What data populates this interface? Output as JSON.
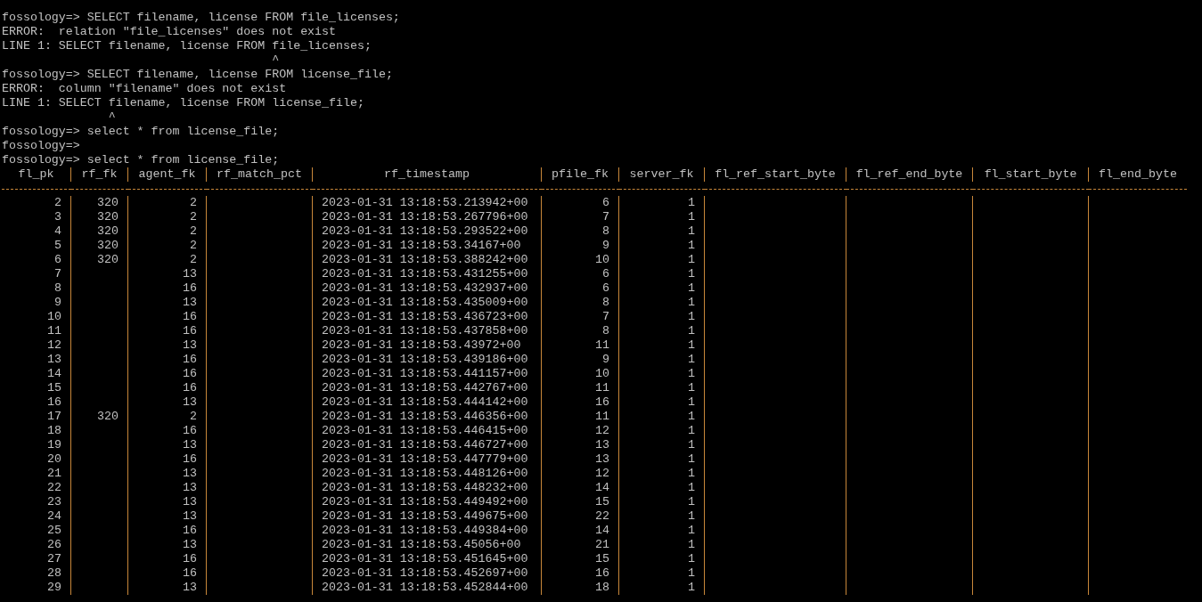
{
  "terminal": {
    "lines": [
      "fossology=> SELECT filename, license FROM file_licenses;",
      "ERROR:  relation \"file_licenses\" does not exist",
      "LINE 1: SELECT filename, license FROM file_licenses;",
      "                                      ^",
      "fossology=> SELECT filename, license FROM license_file;",
      "ERROR:  column \"filename\" does not exist",
      "LINE 1: SELECT filename, license FROM license_file;",
      "               ^",
      "fossology=> select * from license_file;",
      "fossology=>",
      "fossology=> select * from license_file;"
    ],
    "table": {
      "columns": [
        "fl_pk",
        "rf_fk",
        "agent_fk",
        "rf_match_pct",
        "rf_timestamp",
        "pfile_fk",
        "server_fk",
        "fl_ref_start_byte",
        "fl_ref_end_byte",
        "fl_start_byte",
        "fl_end_byte"
      ],
      "rows": [
        [
          "2",
          "320",
          "2",
          null,
          "2023-01-31 13:18:53.213942+00",
          "6",
          "1",
          null,
          null,
          null,
          null
        ],
        [
          "3",
          "320",
          "2",
          null,
          "2023-01-31 13:18:53.267796+00",
          "7",
          "1",
          null,
          null,
          null,
          null
        ],
        [
          "4",
          "320",
          "2",
          null,
          "2023-01-31 13:18:53.293522+00",
          "8",
          "1",
          null,
          null,
          null,
          null
        ],
        [
          "5",
          "320",
          "2",
          null,
          "2023-01-31 13:18:53.34167+00",
          "9",
          "1",
          null,
          null,
          null,
          null
        ],
        [
          "6",
          "320",
          "2",
          null,
          "2023-01-31 13:18:53.388242+00",
          "10",
          "1",
          null,
          null,
          null,
          null
        ],
        [
          "7",
          null,
          "13",
          null,
          "2023-01-31 13:18:53.431255+00",
          "6",
          "1",
          null,
          null,
          null,
          null
        ],
        [
          "8",
          null,
          "16",
          null,
          "2023-01-31 13:18:53.432937+00",
          "6",
          "1",
          null,
          null,
          null,
          null
        ],
        [
          "9",
          null,
          "13",
          null,
          "2023-01-31 13:18:53.435009+00",
          "8",
          "1",
          null,
          null,
          null,
          null
        ],
        [
          "10",
          null,
          "16",
          null,
          "2023-01-31 13:18:53.436723+00",
          "7",
          "1",
          null,
          null,
          null,
          null
        ],
        [
          "11",
          null,
          "16",
          null,
          "2023-01-31 13:18:53.437858+00",
          "8",
          "1",
          null,
          null,
          null,
          null
        ],
        [
          "12",
          null,
          "13",
          null,
          "2023-01-31 13:18:53.43972+00",
          "11",
          "1",
          null,
          null,
          null,
          null
        ],
        [
          "13",
          null,
          "16",
          null,
          "2023-01-31 13:18:53.439186+00",
          "9",
          "1",
          null,
          null,
          null,
          null
        ],
        [
          "14",
          null,
          "16",
          null,
          "2023-01-31 13:18:53.441157+00",
          "10",
          "1",
          null,
          null,
          null,
          null
        ],
        [
          "15",
          null,
          "16",
          null,
          "2023-01-31 13:18:53.442767+00",
          "11",
          "1",
          null,
          null,
          null,
          null
        ],
        [
          "16",
          null,
          "13",
          null,
          "2023-01-31 13:18:53.444142+00",
          "16",
          "1",
          null,
          null,
          null,
          null
        ],
        [
          "17",
          "320",
          "2",
          null,
          "2023-01-31 13:18:53.446356+00",
          "11",
          "1",
          null,
          null,
          null,
          null
        ],
        [
          "18",
          null,
          "16",
          null,
          "2023-01-31 13:18:53.446415+00",
          "12",
          "1",
          null,
          null,
          null,
          null
        ],
        [
          "19",
          null,
          "13",
          null,
          "2023-01-31 13:18:53.446727+00",
          "13",
          "1",
          null,
          null,
          null,
          null
        ],
        [
          "20",
          null,
          "16",
          null,
          "2023-01-31 13:18:53.447779+00",
          "13",
          "1",
          null,
          null,
          null,
          null
        ],
        [
          "21",
          null,
          "13",
          null,
          "2023-01-31 13:18:53.448126+00",
          "12",
          "1",
          null,
          null,
          null,
          null
        ],
        [
          "22",
          null,
          "13",
          null,
          "2023-01-31 13:18:53.448232+00",
          "14",
          "1",
          null,
          null,
          null,
          null
        ],
        [
          "23",
          null,
          "13",
          null,
          "2023-01-31 13:18:53.449492+00",
          "15",
          "1",
          null,
          null,
          null,
          null
        ],
        [
          "24",
          null,
          "13",
          null,
          "2023-01-31 13:18:53.449675+00",
          "22",
          "1",
          null,
          null,
          null,
          null
        ],
        [
          "25",
          null,
          "16",
          null,
          "2023-01-31 13:18:53.449384+00",
          "14",
          "1",
          null,
          null,
          null,
          null
        ],
        [
          "26",
          null,
          "13",
          null,
          "2023-01-31 13:18:53.45056+00",
          "21",
          "1",
          null,
          null,
          null,
          null
        ],
        [
          "27",
          null,
          "16",
          null,
          "2023-01-31 13:18:53.451645+00",
          "15",
          "1",
          null,
          null,
          null,
          null
        ],
        [
          "28",
          null,
          "16",
          null,
          "2023-01-31 13:18:53.452697+00",
          "16",
          "1",
          null,
          null,
          null,
          null
        ],
        [
          "29",
          null,
          "13",
          null,
          "2023-01-31 13:18:53.452844+00",
          "18",
          "1",
          null,
          null,
          null,
          null
        ]
      ]
    }
  }
}
